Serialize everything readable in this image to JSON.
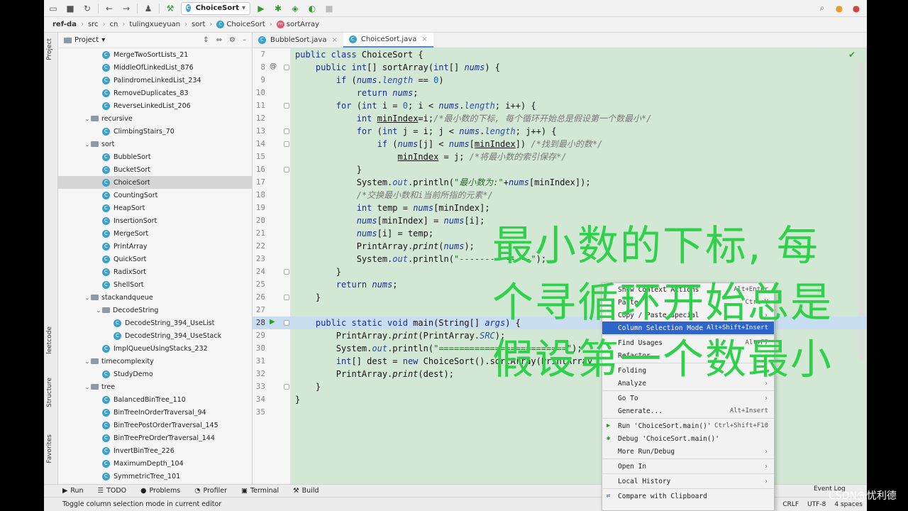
{
  "toolbar": {
    "run_config": "ChoiceSort"
  },
  "breadcrumb": [
    "ref-da",
    "src",
    "cn",
    "tulingxueyuan",
    "sort",
    "ChoiceSort",
    "sortArray"
  ],
  "project": {
    "title": "Project",
    "tree": [
      {
        "label": "MergeTwoSortLists_21",
        "kind": "class",
        "depth": 3
      },
      {
        "label": "MiddleOfLinkedList_876",
        "kind": "class",
        "depth": 3
      },
      {
        "label": "PalindromeLinkedList_234",
        "kind": "class",
        "depth": 3
      },
      {
        "label": "RemoveDuplicates_83",
        "kind": "class",
        "depth": 3
      },
      {
        "label": "ReverseLinkedList_206",
        "kind": "class",
        "depth": 3
      },
      {
        "label": "recursive",
        "kind": "folder",
        "depth": 2
      },
      {
        "label": "ClimbingStairs_70",
        "kind": "class",
        "depth": 3
      },
      {
        "label": "sort",
        "kind": "folder",
        "depth": 2
      },
      {
        "label": "BubbleSort",
        "kind": "class",
        "depth": 3
      },
      {
        "label": "BucketSort",
        "kind": "class",
        "depth": 3
      },
      {
        "label": "ChoiceSort",
        "kind": "class",
        "depth": 3,
        "selected": true
      },
      {
        "label": "CountingSort",
        "kind": "class",
        "depth": 3
      },
      {
        "label": "HeapSort",
        "kind": "class",
        "depth": 3
      },
      {
        "label": "InsertionSort",
        "kind": "class",
        "depth": 3
      },
      {
        "label": "MergeSort",
        "kind": "class",
        "depth": 3
      },
      {
        "label": "PrintArray",
        "kind": "class",
        "depth": 3
      },
      {
        "label": "QuickSort",
        "kind": "class",
        "depth": 3
      },
      {
        "label": "RadixSort",
        "kind": "class",
        "depth": 3
      },
      {
        "label": "ShellSort",
        "kind": "class",
        "depth": 3
      },
      {
        "label": "stackandqueue",
        "kind": "folder",
        "depth": 2
      },
      {
        "label": "DecodeString",
        "kind": "folder",
        "depth": 3
      },
      {
        "label": "DecodeString_394_UseList",
        "kind": "class",
        "depth": 4
      },
      {
        "label": "DecodeString_394_UseStack",
        "kind": "class",
        "depth": 4
      },
      {
        "label": "ImplQueueUsingStacks_232",
        "kind": "class",
        "depth": 3
      },
      {
        "label": "timecomplexity",
        "kind": "folder",
        "depth": 2
      },
      {
        "label": "StudyDemo",
        "kind": "class",
        "depth": 3
      },
      {
        "label": "tree",
        "kind": "folder",
        "depth": 2
      },
      {
        "label": "BalancedBinTree_110",
        "kind": "class",
        "depth": 3
      },
      {
        "label": "BinTreeInOrderTraversal_94",
        "kind": "class",
        "depth": 3
      },
      {
        "label": "BinTreePostOrderTraversal_145",
        "kind": "class",
        "depth": 3
      },
      {
        "label": "BinTreePreOrderTraversal_144",
        "kind": "class",
        "depth": 3
      },
      {
        "label": "InvertBinTree_226",
        "kind": "class",
        "depth": 3
      },
      {
        "label": "MaximumDepth_104",
        "kind": "class",
        "depth": 3
      },
      {
        "label": "SymmetricTree_101",
        "kind": "class",
        "depth": 3
      }
    ]
  },
  "left_tabs": [
    "Project",
    "leetcode",
    "Structure",
    "Favorites"
  ],
  "tabs": [
    {
      "label": "BubbleSort.java",
      "active": false
    },
    {
      "label": "ChoiceSort.java",
      "active": true
    }
  ],
  "code_lines": [
    {
      "n": "7",
      "html": "<span class='kw'>public class</span> ChoiceSort {"
    },
    {
      "n": "8",
      "html": "    <span class='kw'>public int</span>[] sortArray(<span class='kw'>int</span>[] <span class='it'>nums</span>) {"
    },
    {
      "n": "9",
      "html": "        <span class='kw'>if</span> (<span class='it'>nums</span>.<span class='fld'>length</span> == <span class='num'>0</span>)"
    },
    {
      "n": "10",
      "html": "            <span class='kw'>return</span> <span class='it'>nums</span>;"
    },
    {
      "n": "11",
      "html": "        <span class='kw'>for</span> (<span class='kw'>int</span> i = <span class='num'>0</span>; i &lt; <span class='it'>nums</span>.<span class='fld'>length</span>; i++) {"
    },
    {
      "n": "12",
      "html": "            <span class='kw'>int</span> <u>minIndex</u>=i;<span class='cm'>/*最小数的下标, 每个循环开始总是假设第一个数最小*/</span>"
    },
    {
      "n": "13",
      "html": "            <span class='kw'>for</span> (<span class='kw'>int</span> j = i; j &lt; <span class='it'>nums</span>.<span class='fld'>length</span>; j++) {"
    },
    {
      "n": "14",
      "html": "                <span class='kw'>if</span> (<span class='it'>nums</span>[j] &lt; <span class='it'>nums</span>[<u>minIndex</u>]) <span class='cm'>/*找到最小的数*/</span>"
    },
    {
      "n": "15",
      "html": "                    <u>minIndex</u> = j; <span class='cm'>/*将最小数的索引保存*/</span>"
    },
    {
      "n": "16",
      "html": "            }"
    },
    {
      "n": "17",
      "html": "            System.<span class='fld'>out</span>.println(<span class='str'>\"<i>最小数为:</i>\"</span>+<span class='it'>nums</span>[minIndex]);"
    },
    {
      "n": "18",
      "html": "            <span class='cm'>/*交换最小数和i当前所指的元素*/</span>"
    },
    {
      "n": "19",
      "html": "            <span class='kw'>int</span> temp = <span class='it'>nums</span>[minIndex];"
    },
    {
      "n": "20",
      "html": "            <span class='it'>nums</span>[minIndex] = <span class='it'>nums</span>[i];"
    },
    {
      "n": "21",
      "html": "            <span class='it'>nums</span>[i] = temp;"
    },
    {
      "n": "22",
      "html": "            PrintArray.<i>print</i>(<span class='it'>nums</span>);"
    },
    {
      "n": "23",
      "html": "            System.<span class='fld'>out</span>.println(<span class='str'>\"--------------\"</span>);"
    },
    {
      "n": "24",
      "html": "        }"
    },
    {
      "n": "25",
      "html": "        <span class='kw'>return</span> <span class='it'>nums</span>;"
    },
    {
      "n": "26",
      "html": "    }"
    },
    {
      "n": "27",
      "html": ""
    },
    {
      "n": "28",
      "html": "    <span class='kw'>public static void</span> main(String[] <span class='it'>args</span>) {"
    },
    {
      "n": "29",
      "html": "        PrintArray.<i>print</i>(PrintArray.<span class='fld'>SRC</span>);"
    },
    {
      "n": "30",
      "html": "        System.<span class='fld'>out</span>.println(<span class='str'>\"=========================\"</span>);"
    },
    {
      "n": "31",
      "html": "        <span class='kw'>int</span>[] dest = <span class='kw'>new</span> ChoiceSort().sortArray(PrintArray"
    },
    {
      "n": "32",
      "html": "        PrintArray.<i>print</i>(dest);"
    },
    {
      "n": "33",
      "html": "    }"
    },
    {
      "n": "34",
      "html": "}"
    },
    {
      "n": "35",
      "html": ""
    }
  ],
  "context_menu": [
    {
      "label": "Show Context Actions",
      "shortcut": "Alt+Enter"
    },
    {
      "label": "Paste",
      "shortcut": "Ctrl+V"
    },
    {
      "label": "Copy / Paste Special",
      "sub": true
    },
    {
      "label": "Column Selection Mode",
      "shortcut": "Alt+Shift+Insert",
      "highlight": true
    },
    {
      "sep": true
    },
    {
      "label": "Find Usages",
      "shortcut": "Alt+F7"
    },
    {
      "label": "Refactor",
      "sub": true
    },
    {
      "sep": true
    },
    {
      "label": "Folding",
      "sub": true
    },
    {
      "label": "Analyze",
      "sub": true
    },
    {
      "sep": true
    },
    {
      "label": "Go To",
      "sub": true
    },
    {
      "label": "Generate...",
      "shortcut": "Alt+Insert"
    },
    {
      "sep": true
    },
    {
      "label": "Run 'ChoiceSort.main()'",
      "shortcut": "Ctrl+Shift+F10",
      "icon": "▶"
    },
    {
      "label": "Debug 'ChoiceSort.main()'",
      "icon": "✱"
    },
    {
      "label": "More Run/Debug",
      "sub": true
    },
    {
      "sep": true
    },
    {
      "label": "Open In",
      "sub": true
    },
    {
      "sep": true
    },
    {
      "label": "Local History",
      "sub": true
    },
    {
      "sep": true
    },
    {
      "label": "Compare with Clipboard",
      "icon": "⇄"
    }
  ],
  "overlay_lines": [
    "最小数的下标, 每",
    "个寻循环开始总是",
    "假设第一个数最小"
  ],
  "bottom_tools": [
    "Run",
    "TODO",
    "Problems",
    "Profiler",
    "Terminal",
    "Build"
  ],
  "event_log": "Event Log",
  "status": {
    "message": "Toggle column selection mode in current editor",
    "items": [
      "CRLF",
      "UTF-8",
      "4 spaces"
    ]
  },
  "watermark": "CSDN@忧利德"
}
